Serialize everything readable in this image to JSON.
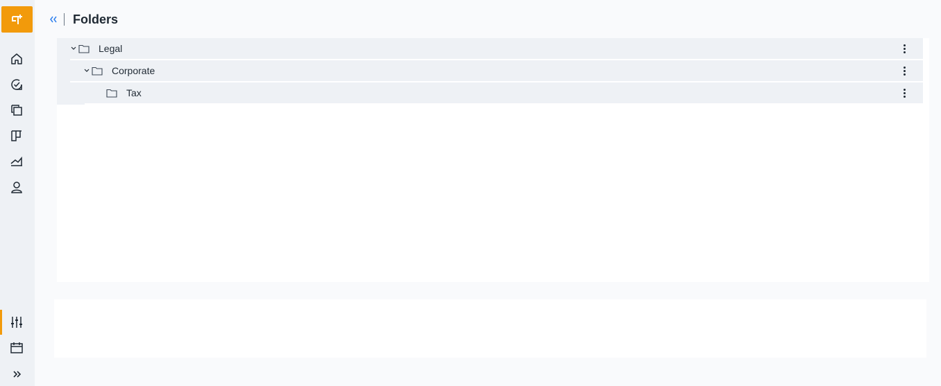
{
  "header": {
    "title": "Folders",
    "collapse_icon": "double-chevron-left-icon"
  },
  "sidebar": {
    "logo_icon": "app-logo-icon",
    "accent": "#f29a0b",
    "items": [
      {
        "icon": "home-icon"
      },
      {
        "icon": "check-circle-icon"
      },
      {
        "icon": "documents-icon"
      },
      {
        "icon": "board-icon"
      },
      {
        "icon": "chart-icon"
      },
      {
        "icon": "user-icon"
      }
    ],
    "bottom_items": [
      {
        "icon": "sliders-icon",
        "active": true
      },
      {
        "icon": "calendar-icon"
      },
      {
        "icon": "double-chevron-right-icon"
      }
    ]
  },
  "tree": {
    "rows": [
      {
        "label": "Legal",
        "level": 0,
        "expanded": true
      },
      {
        "label": "Corporate",
        "level": 1,
        "expanded": true
      },
      {
        "label": "Tax",
        "level": 2,
        "expanded": false
      }
    ]
  }
}
